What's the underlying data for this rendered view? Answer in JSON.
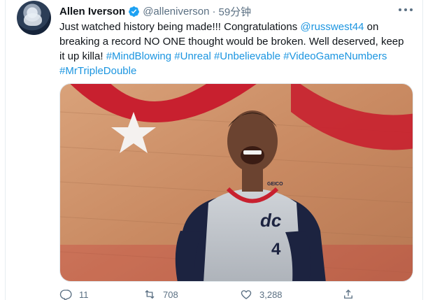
{
  "tweet": {
    "author_name": "Allen Iverson",
    "handle": "@alleniverson",
    "separator": "·",
    "time_ago": "59分钟",
    "text": {
      "line1_a": "Just watched history being made!!! Congratulations ",
      "line1_mention": "@russwest44",
      "line1_b": " on",
      "line2": "breaking a record NO ONE thought would be broken. Well deserved, keep",
      "line3_a": "it up killa! ",
      "hashtags_line3": [
        "#MindBlowing",
        "#Unreal",
        "#Unbelievable",
        "#VideoGameNumbers"
      ],
      "hashtag_line4": "#MrTripleDouble"
    },
    "image": {
      "jersey_logo": "dc",
      "jersey_number": "4",
      "jersey_patch": "GEICO"
    }
  },
  "actions": {
    "reply_count": "11",
    "retweet_count": "708",
    "like_count": "3,288"
  },
  "icons": {
    "verified": "verified-badge-icon",
    "more": "more-icon",
    "reply": "reply-icon",
    "retweet": "retweet-icon",
    "like": "like-icon",
    "share": "share-icon"
  },
  "colors": {
    "link": "#1b95e0",
    "muted": "#5b7083",
    "verified": "#1da1f2"
  }
}
